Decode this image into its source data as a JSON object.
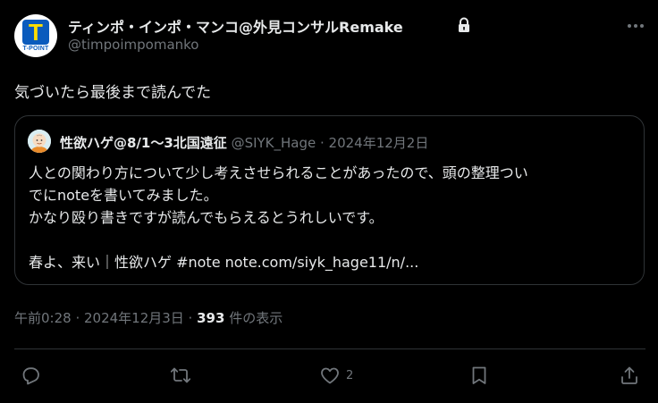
{
  "author": {
    "display_name": "ティンポ・インポ・マンコ@外見コンサルRemake",
    "handle": "@timpoimpomanko",
    "avatar_letter": "T",
    "avatar_caption": "T-POINT",
    "protected": true
  },
  "tweet": {
    "text": "気づいたら最後まで読んでた",
    "timestamp": "午前0:28 · 2024年12月3日 · ",
    "views_count": "393",
    "views_label": " 件の表示"
  },
  "quoted": {
    "name": "性欲ハゲ@8/1〜3北国遠征",
    "meta": " @SIYK_Hage · 2024年12月2日",
    "lines": [
      "人との関わり方について少し考えさせられることがあったので、頭の整理つい",
      "でにnoteを書いてみました。",
      "かなり殴り書きですが読んでもらえるとうれしいです。",
      "",
      "春よ、来い｜性欲ハゲ #note  note.com/siyk_hage11/n/..."
    ]
  },
  "actions": {
    "reply_count": "",
    "retweet_count": "",
    "like_count": "2",
    "bookmark_count": ""
  },
  "colors": {
    "background": "#000000",
    "text_primary": "#e7e9ea",
    "text_secondary": "#71767b",
    "border": "#2f3336",
    "avatar_blue": "#0a5bbd",
    "avatar_yellow": "#ffde00"
  }
}
